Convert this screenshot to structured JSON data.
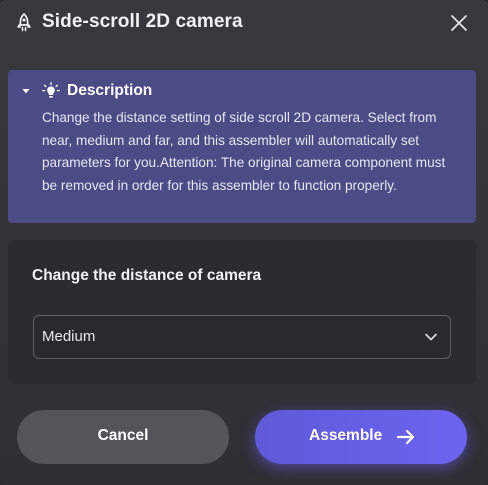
{
  "dialog": {
    "title": "Side-scroll 2D camera",
    "icons": {
      "title": "rocket-icon",
      "close": "close-icon"
    }
  },
  "description": {
    "title": "Description",
    "body": "Change the distance setting of side scroll 2D camera. Select from near, medium and far, and this assembler will automatically set parameters for you.Attention: The original camera component must be removed in order for this assembler to function properly.",
    "expanded": true,
    "icons": {
      "toggle": "caret-down-icon",
      "title": "lightbulb-icon"
    },
    "background": "#4b4b86"
  },
  "settings": {
    "label": "Change the distance of camera",
    "select": {
      "value": "Medium",
      "icon": "chevron-down-icon"
    }
  },
  "buttons": {
    "cancel_label": "Cancel",
    "assemble_label": "Assemble",
    "assemble_icon": "arrow-right-icon"
  },
  "colors": {
    "accent": "#6a5fe8",
    "dialog_background": "#333338",
    "card_background": "#2c2c30",
    "cancel_background": "#545459",
    "text_primary": "#f2f2f4"
  }
}
